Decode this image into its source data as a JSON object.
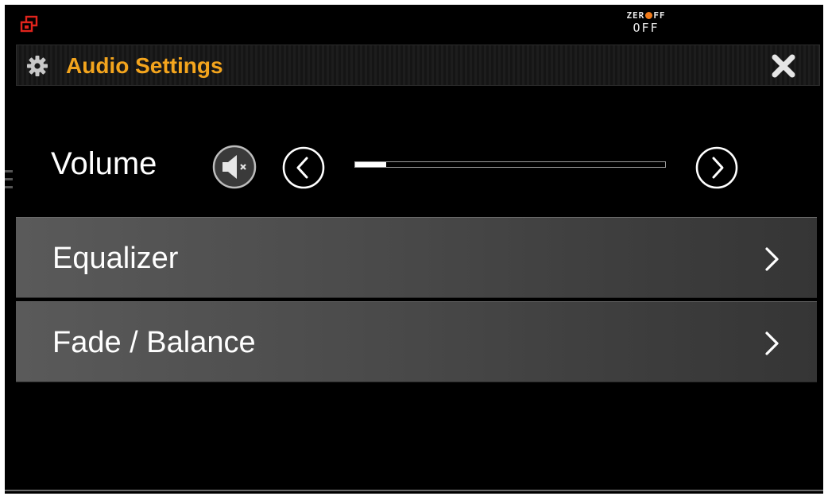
{
  "status_bar": {
    "app_icon": "window-restore-icon",
    "zero_off": {
      "prefix": "ZER",
      "suffix": "FF",
      "state": "OFF",
      "dot_color": "#f07a1a"
    }
  },
  "header": {
    "icon": "gear-icon",
    "title": "Audio Settings",
    "title_color": "#f4a51d",
    "close_icon": "close-icon"
  },
  "volume": {
    "label": "Volume",
    "mute_icon": "speaker-mute-icon",
    "decrease_icon": "chevron-left-circle-icon",
    "increase_icon": "chevron-right-circle-icon",
    "level_percent": 10
  },
  "menu": {
    "items": [
      {
        "label": "Equalizer",
        "icon": "chevron-right-icon"
      },
      {
        "label": "Fade / Balance",
        "icon": "chevron-right-icon"
      }
    ]
  }
}
